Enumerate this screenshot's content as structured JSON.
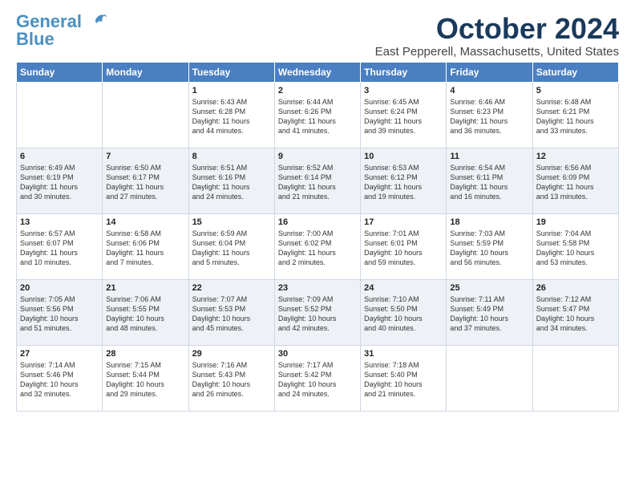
{
  "header": {
    "logo_general": "General",
    "logo_blue": "Blue",
    "month_title": "October 2024",
    "location": "East Pepperell, Massachusetts, United States"
  },
  "weekdays": [
    "Sunday",
    "Monday",
    "Tuesday",
    "Wednesday",
    "Thursday",
    "Friday",
    "Saturday"
  ],
  "weeks": [
    [
      {
        "day": "",
        "content": ""
      },
      {
        "day": "",
        "content": ""
      },
      {
        "day": "1",
        "content": "Sunrise: 6:43 AM\nSunset: 6:28 PM\nDaylight: 11 hours\nand 44 minutes."
      },
      {
        "day": "2",
        "content": "Sunrise: 6:44 AM\nSunset: 6:26 PM\nDaylight: 11 hours\nand 41 minutes."
      },
      {
        "day": "3",
        "content": "Sunrise: 6:45 AM\nSunset: 6:24 PM\nDaylight: 11 hours\nand 39 minutes."
      },
      {
        "day": "4",
        "content": "Sunrise: 6:46 AM\nSunset: 6:23 PM\nDaylight: 11 hours\nand 36 minutes."
      },
      {
        "day": "5",
        "content": "Sunrise: 6:48 AM\nSunset: 6:21 PM\nDaylight: 11 hours\nand 33 minutes."
      }
    ],
    [
      {
        "day": "6",
        "content": "Sunrise: 6:49 AM\nSunset: 6:19 PM\nDaylight: 11 hours\nand 30 minutes."
      },
      {
        "day": "7",
        "content": "Sunrise: 6:50 AM\nSunset: 6:17 PM\nDaylight: 11 hours\nand 27 minutes."
      },
      {
        "day": "8",
        "content": "Sunrise: 6:51 AM\nSunset: 6:16 PM\nDaylight: 11 hours\nand 24 minutes."
      },
      {
        "day": "9",
        "content": "Sunrise: 6:52 AM\nSunset: 6:14 PM\nDaylight: 11 hours\nand 21 minutes."
      },
      {
        "day": "10",
        "content": "Sunrise: 6:53 AM\nSunset: 6:12 PM\nDaylight: 11 hours\nand 19 minutes."
      },
      {
        "day": "11",
        "content": "Sunrise: 6:54 AM\nSunset: 6:11 PM\nDaylight: 11 hours\nand 16 minutes."
      },
      {
        "day": "12",
        "content": "Sunrise: 6:56 AM\nSunset: 6:09 PM\nDaylight: 11 hours\nand 13 minutes."
      }
    ],
    [
      {
        "day": "13",
        "content": "Sunrise: 6:57 AM\nSunset: 6:07 PM\nDaylight: 11 hours\nand 10 minutes."
      },
      {
        "day": "14",
        "content": "Sunrise: 6:58 AM\nSunset: 6:06 PM\nDaylight: 11 hours\nand 7 minutes."
      },
      {
        "day": "15",
        "content": "Sunrise: 6:59 AM\nSunset: 6:04 PM\nDaylight: 11 hours\nand 5 minutes."
      },
      {
        "day": "16",
        "content": "Sunrise: 7:00 AM\nSunset: 6:02 PM\nDaylight: 11 hours\nand 2 minutes."
      },
      {
        "day": "17",
        "content": "Sunrise: 7:01 AM\nSunset: 6:01 PM\nDaylight: 10 hours\nand 59 minutes."
      },
      {
        "day": "18",
        "content": "Sunrise: 7:03 AM\nSunset: 5:59 PM\nDaylight: 10 hours\nand 56 minutes."
      },
      {
        "day": "19",
        "content": "Sunrise: 7:04 AM\nSunset: 5:58 PM\nDaylight: 10 hours\nand 53 minutes."
      }
    ],
    [
      {
        "day": "20",
        "content": "Sunrise: 7:05 AM\nSunset: 5:56 PM\nDaylight: 10 hours\nand 51 minutes."
      },
      {
        "day": "21",
        "content": "Sunrise: 7:06 AM\nSunset: 5:55 PM\nDaylight: 10 hours\nand 48 minutes."
      },
      {
        "day": "22",
        "content": "Sunrise: 7:07 AM\nSunset: 5:53 PM\nDaylight: 10 hours\nand 45 minutes."
      },
      {
        "day": "23",
        "content": "Sunrise: 7:09 AM\nSunset: 5:52 PM\nDaylight: 10 hours\nand 42 minutes."
      },
      {
        "day": "24",
        "content": "Sunrise: 7:10 AM\nSunset: 5:50 PM\nDaylight: 10 hours\nand 40 minutes."
      },
      {
        "day": "25",
        "content": "Sunrise: 7:11 AM\nSunset: 5:49 PM\nDaylight: 10 hours\nand 37 minutes."
      },
      {
        "day": "26",
        "content": "Sunrise: 7:12 AM\nSunset: 5:47 PM\nDaylight: 10 hours\nand 34 minutes."
      }
    ],
    [
      {
        "day": "27",
        "content": "Sunrise: 7:14 AM\nSunset: 5:46 PM\nDaylight: 10 hours\nand 32 minutes."
      },
      {
        "day": "28",
        "content": "Sunrise: 7:15 AM\nSunset: 5:44 PM\nDaylight: 10 hours\nand 29 minutes."
      },
      {
        "day": "29",
        "content": "Sunrise: 7:16 AM\nSunset: 5:43 PM\nDaylight: 10 hours\nand 26 minutes."
      },
      {
        "day": "30",
        "content": "Sunrise: 7:17 AM\nSunset: 5:42 PM\nDaylight: 10 hours\nand 24 minutes."
      },
      {
        "day": "31",
        "content": "Sunrise: 7:18 AM\nSunset: 5:40 PM\nDaylight: 10 hours\nand 21 minutes."
      },
      {
        "day": "",
        "content": ""
      },
      {
        "day": "",
        "content": ""
      }
    ]
  ]
}
